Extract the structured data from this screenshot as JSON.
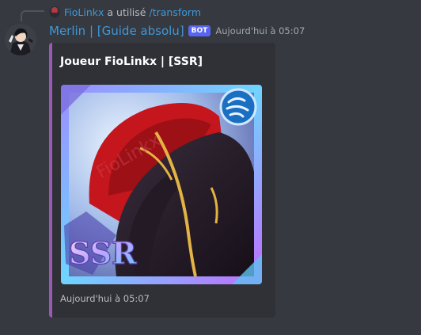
{
  "reply": {
    "username": "FioLinkx",
    "action_text": "a utilisé",
    "command": "/transform"
  },
  "author": {
    "name": "Merlin | [Guide absolu]",
    "bot_badge": "BOT",
    "timestamp": "Aujourd'hui à 05:07"
  },
  "embed": {
    "accent_color": "#9b59b6",
    "title": "Joueur FioLinkx | [SSR]",
    "image": {
      "watermark": "FioLinkx",
      "rarity_badge": "SSR",
      "element_icon": "wind-icon"
    },
    "footer": "Aujourd'hui à 05:07"
  },
  "colors": {
    "background": "#36393f",
    "embed_background": "#2f3136",
    "link": "#3f98d8",
    "bot_badge": "#5865f2"
  }
}
